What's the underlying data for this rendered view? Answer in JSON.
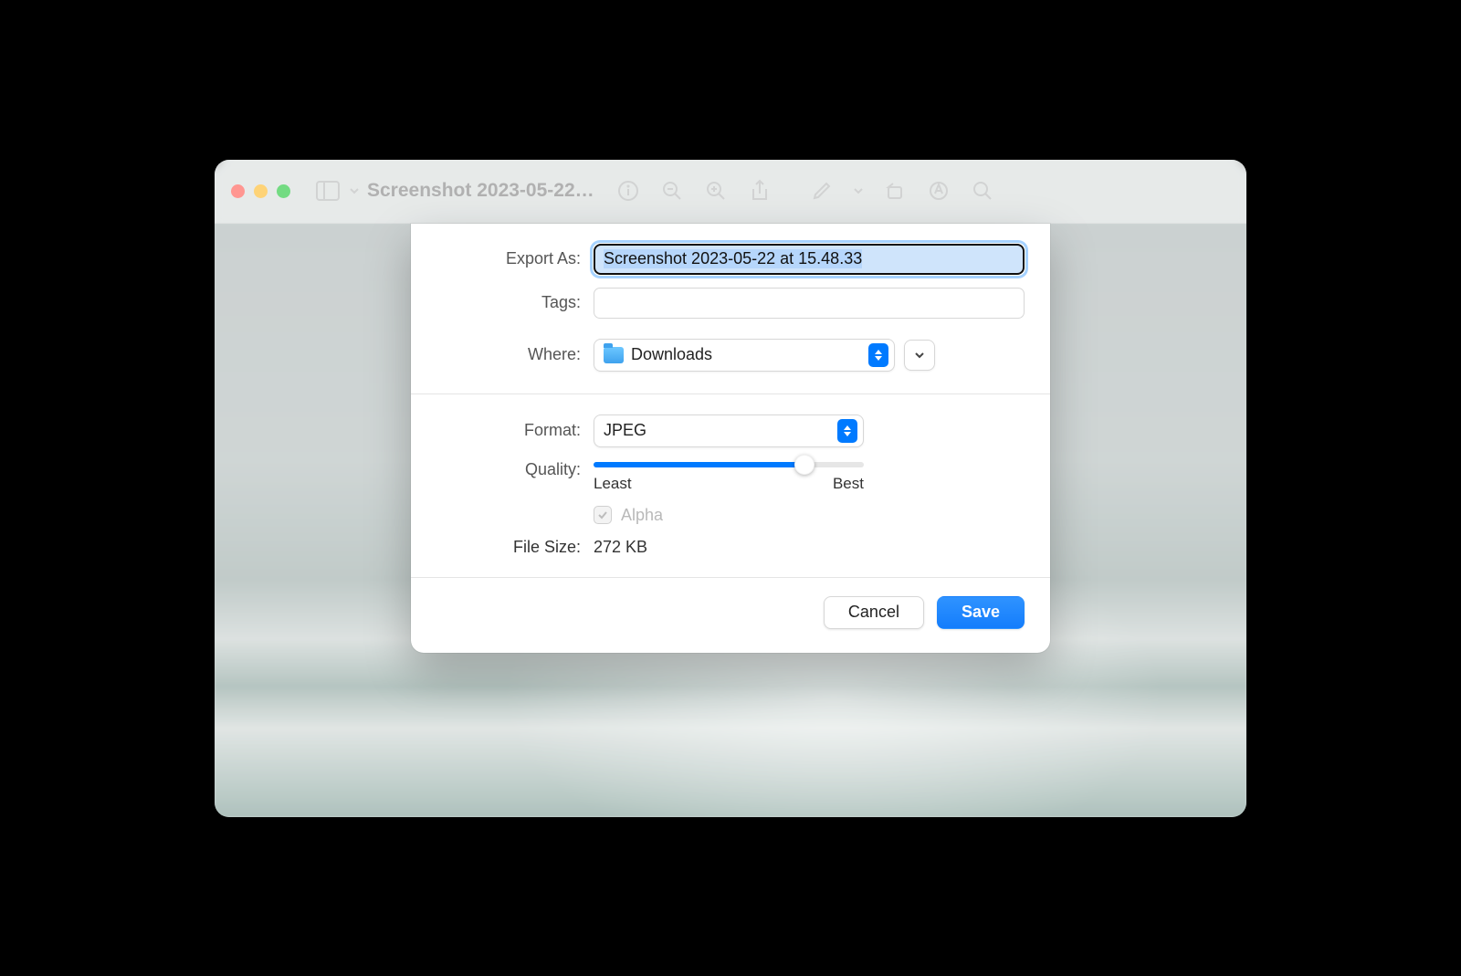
{
  "window": {
    "title": "Screenshot 2023-05-22…"
  },
  "export": {
    "export_as_label": "Export As:",
    "export_as_value": "Screenshot 2023-05-22 at 15.48.33",
    "tags_label": "Tags:",
    "tags_value": "",
    "where_label": "Where:",
    "where_value": "Downloads",
    "format_label": "Format:",
    "format_value": "JPEG",
    "quality_label": "Quality:",
    "quality_percent": 78,
    "quality_least": "Least",
    "quality_best": "Best",
    "alpha_label": "Alpha",
    "alpha_checked": true,
    "alpha_disabled": true,
    "file_size_label": "File Size:",
    "file_size_value": "272 KB",
    "cancel_label": "Cancel",
    "save_label": "Save"
  },
  "colors": {
    "accent": "#007aff"
  }
}
